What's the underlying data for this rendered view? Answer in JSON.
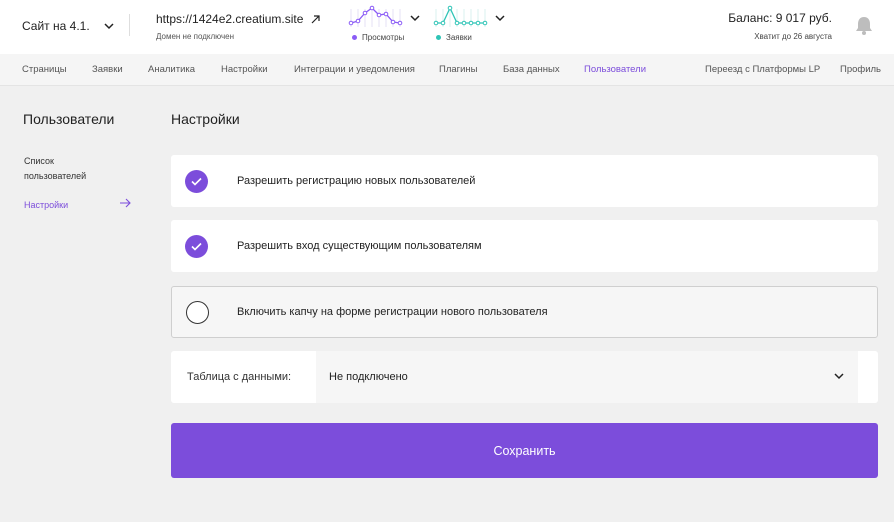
{
  "header": {
    "site_select": "Сайт на 4.1.",
    "domain_url": "https://1424e2.creatium.site",
    "domain_status": "Домен не подключен",
    "stats": [
      {
        "label": "Просмотры",
        "color": "#8b5cf6"
      },
      {
        "label": "Заявки",
        "color": "#2ec4b6"
      }
    ],
    "balance": "Баланс: 9 017 руб.",
    "balance_note": "Хватит до 26 августа"
  },
  "nav": {
    "items": [
      "Страницы",
      "Заявки",
      "Аналитика",
      "Настройки",
      "Интеграции и уведомления",
      "Плагины",
      "База данных",
      "Пользователи"
    ],
    "right_items": [
      "Переезд с Платформы LP",
      "Профиль"
    ],
    "active": "Пользователи"
  },
  "sidebar": {
    "title": "Пользователи",
    "items": [
      {
        "label": "Список пользователей",
        "active": false
      },
      {
        "label": "Настройки",
        "active": true
      }
    ]
  },
  "main": {
    "title": "Настройки",
    "options": [
      {
        "label": "Разрешить регистрацию новых пользователей",
        "checked": true
      },
      {
        "label": "Разрешить вход существующим пользователям",
        "checked": true
      },
      {
        "label": "Включить капчу на форме регистрации нового пользователя",
        "checked": false
      }
    ],
    "table_label": "Таблица с данными:",
    "table_value": "Не подключено",
    "save_label": "Сохранить"
  },
  "colors": {
    "accent": "#7c4ddb",
    "teal": "#2ec4b6"
  }
}
